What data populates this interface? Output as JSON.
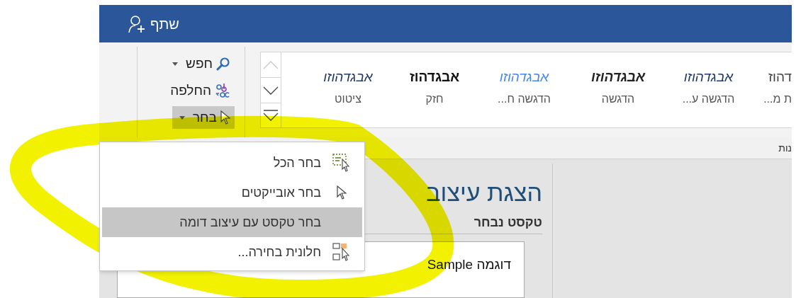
{
  "title_bar": {
    "share_button": "שתף"
  },
  "editing_group": {
    "items": [
      {
        "kind": "find",
        "label": "חפש",
        "dropdown": true,
        "selected": false
      },
      {
        "kind": "replace",
        "label": "החלפה",
        "dropdown": false,
        "selected": false
      },
      {
        "kind": "select",
        "label": "בחר",
        "dropdown": true,
        "selected": true
      }
    ]
  },
  "styles_gallery": {
    "items": [
      {
        "kind": "plain",
        "sample": "דהוז",
        "label": "ת מ..."
      },
      {
        "kind": "italic",
        "sample": "אבגדהוזו",
        "label": "הדגשה ע..."
      },
      {
        "kind": "bold-italic",
        "sample": "אבגדהוזו",
        "label": "הדגשה"
      },
      {
        "kind": "accent",
        "sample": "אבגדהוזו",
        "label": "הדגשה ח..."
      },
      {
        "kind": "bold",
        "sample": "אבגדהוז",
        "label": "חזק"
      },
      {
        "kind": "italic",
        "sample": "אבגדהוזו",
        "label": "ציטוט"
      }
    ]
  },
  "styles_group_label": "נות",
  "select_menu": {
    "items": [
      {
        "kind": "select-all",
        "label": "בחר הכל",
        "selected": false
      },
      {
        "kind": "objects",
        "label": "בחר אובייקטים",
        "selected": false
      },
      {
        "kind": "similar",
        "label": "בחר טקסט עם עיצוב דומה",
        "selected": true
      },
      {
        "kind": "pane",
        "label": "חלונית בחירה...",
        "selected": false
      }
    ]
  },
  "style_inspector": {
    "title": "הצגת עיצוב",
    "heading": "טקסט נבחר",
    "sample": "Sample דוגמה"
  }
}
